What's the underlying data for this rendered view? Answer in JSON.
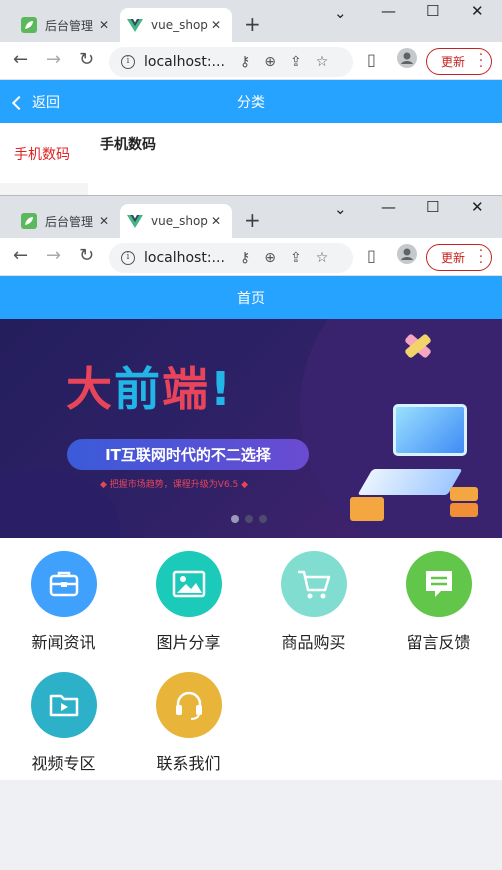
{
  "window1": {
    "tabs": [
      {
        "title": "后台管理",
        "active": false
      },
      {
        "title": "vue_shop",
        "active": true
      }
    ],
    "address": "localhost:...",
    "update_label": "更新",
    "header": {
      "back_label": "返回",
      "title": "分类"
    },
    "category": {
      "left_item": "手机数码",
      "section_title": "手机数码"
    }
  },
  "window2": {
    "tabs": [
      {
        "title": "后台管理",
        "active": false
      },
      {
        "title": "vue_shop",
        "active": true
      }
    ],
    "address": "localhost:...",
    "update_label": "更新",
    "header": {
      "title": "首页"
    },
    "banner": {
      "title_part1": "大",
      "title_part2": "前",
      "title_part3": "端",
      "title_mark": "!",
      "slogan": "IT互联网时代的不二选择",
      "sub": "◆ 把握市场趋势，课程升级为V6.5 ◆"
    },
    "grid": [
      {
        "label": "新闻资讯",
        "icon": "briefcase-icon",
        "color": "#3fa1fb"
      },
      {
        "label": "图片分享",
        "icon": "picture-icon",
        "color": "#1ccaba"
      },
      {
        "label": "商品购买",
        "icon": "cart-icon",
        "color": "#81ddd0"
      },
      {
        "label": "留言反馈",
        "icon": "message-icon",
        "color": "#61c64a"
      },
      {
        "label": "视频专区",
        "icon": "video-folder-icon",
        "color": "#2db1c9"
      },
      {
        "label": "联系我们",
        "icon": "headset-icon",
        "color": "#e8b43a"
      }
    ]
  }
}
